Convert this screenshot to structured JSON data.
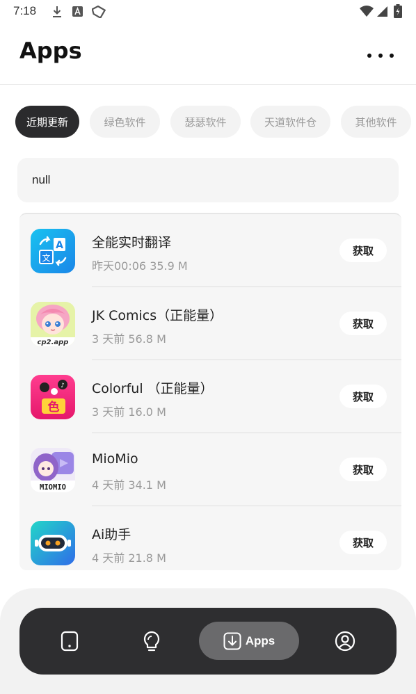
{
  "status_bar": {
    "time": "7:18"
  },
  "header": {
    "title": "Apps"
  },
  "tabs": [
    {
      "label": "近期更新",
      "active": true
    },
    {
      "label": "绿色软件",
      "active": false
    },
    {
      "label": "瑟瑟软件",
      "active": false
    },
    {
      "label": "天道软件仓",
      "active": false
    },
    {
      "label": "其他软件",
      "active": false
    }
  ],
  "search": {
    "value": "null"
  },
  "apps": [
    {
      "name": "全能实时翻译",
      "meta": "昨天00:06   35.9 M",
      "button": "获取",
      "icon": "translate-app-icon"
    },
    {
      "name": "JK Comics（正能量）",
      "meta": "3 天前   56.8 M",
      "button": "获取",
      "icon": "jk-comics-app-icon",
      "icon_text": "cp2.app"
    },
    {
      "name": "Colorful （正能量）",
      "meta": "3 天前   16.0 M",
      "button": "获取",
      "icon": "colorful-app-icon",
      "icon_text": "色"
    },
    {
      "name": "MioMio",
      "meta": "4 天前   34.1 M",
      "button": "获取",
      "icon": "miomio-app-icon",
      "icon_text": "MIOMIO"
    },
    {
      "name": "Ai助手",
      "meta": "4 天前   21.8 M",
      "button": "获取",
      "icon": "ai-assistant-app-icon"
    }
  ],
  "nav": {
    "items": [
      {
        "icon": "phone-icon"
      },
      {
        "icon": "lightbulb-icon"
      },
      {
        "icon": "download-icon",
        "label": "Apps",
        "active": true
      },
      {
        "icon": "profile-icon"
      }
    ]
  },
  "colors": {
    "active_tab": "#2b2b2d",
    "nav_bar": "#2e2e30",
    "nav_active": "#6a6a6c"
  }
}
